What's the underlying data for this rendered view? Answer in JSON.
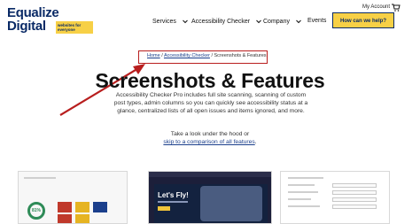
{
  "header": {
    "logo_line1": "Equalize",
    "logo_line2": "Digital",
    "logo_tagline": "websites for everyone",
    "account_label": "My Account",
    "nav": [
      {
        "label": "Services",
        "icon": "chevron-down-icon"
      },
      {
        "label": "Accessibility Checker",
        "icon": "chevron-down-icon"
      },
      {
        "label": "Company",
        "icon": "chevron-down-icon"
      },
      {
        "label": "Events"
      }
    ],
    "cta_label": "How can we help?"
  },
  "breadcrumb": {
    "home": "Home",
    "sep1": " / ",
    "parent": "Accessibility Checker",
    "sep2": " / ",
    "current": "Screenshots & Features"
  },
  "page": {
    "title": "Screenshots & Features",
    "intro": "Accessibility Checker Pro includes full site scanning, scanning of custom post types, admin columns so you can quickly see accessibility status at a glance, centralized lists of all open issues and items ignored, and more.",
    "look_text": "Take a look under the hood or",
    "skip_link": "skip to a comparison of all features",
    "skip_suffix": "."
  },
  "cards": {
    "card1_percent": "81%",
    "card2_title": "Let's Fly!"
  },
  "colors": {
    "brand_navy": "#0a2a66",
    "brand_yellow": "#f7d046",
    "annotation_red": "#b81e1e"
  }
}
